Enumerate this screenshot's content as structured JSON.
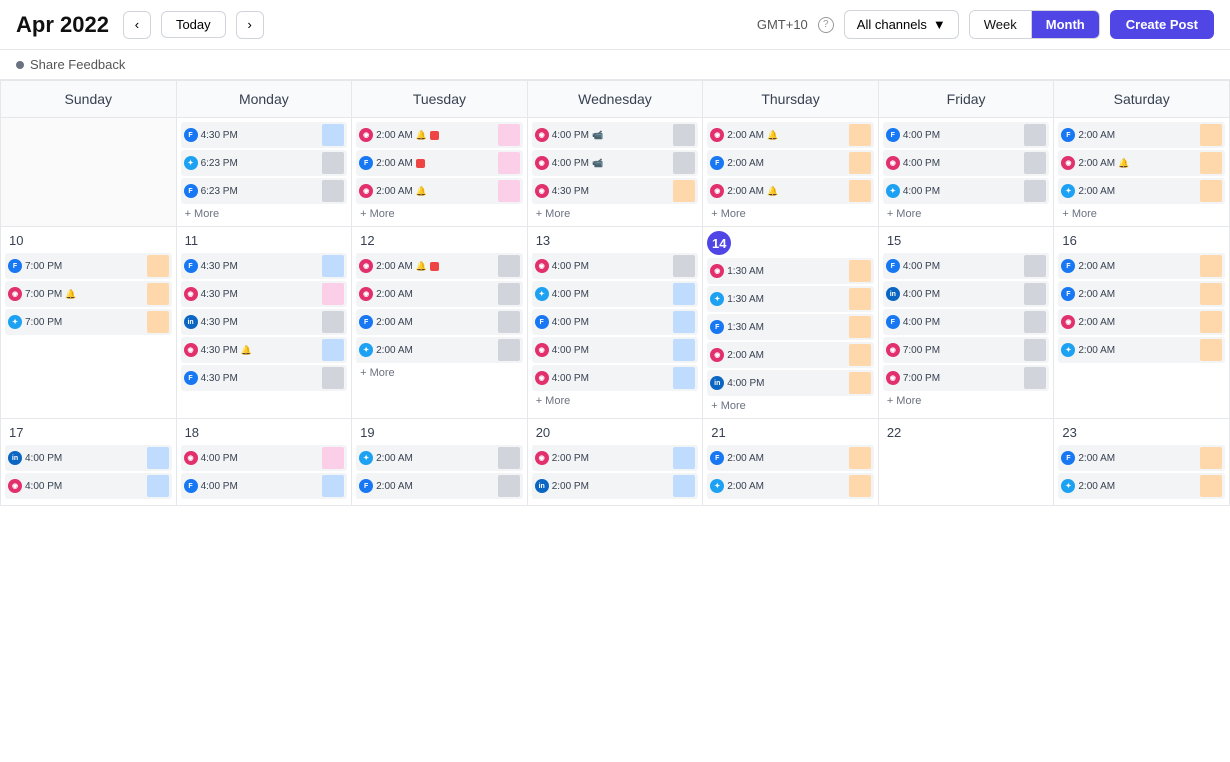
{
  "header": {
    "title": "Apr 2022",
    "today_label": "Today",
    "gmt": "GMT+10",
    "channels_label": "All channels",
    "view_week": "Week",
    "view_month": "Month",
    "create_label": "Create Post"
  },
  "feedback": {
    "label": "Share Feedback"
  },
  "weekdays": [
    "Sunday",
    "Monday",
    "Tuesday",
    "Wednesday",
    "Thursday",
    "Friday",
    "Saturday"
  ],
  "weeks": [
    {
      "days": [
        {
          "num": "",
          "empty": true,
          "events": []
        },
        {
          "num": "",
          "events": [
            {
              "social": "fb",
              "time": "4:30 PM",
              "thumb": "blue"
            },
            {
              "social": "tw",
              "time": "6:23 PM",
              "thumb": "gray"
            },
            {
              "social": "fb",
              "time": "6:23 PM",
              "thumb": "gray"
            }
          ],
          "more": true
        },
        {
          "num": "",
          "events": [
            {
              "social": "ig",
              "time": "2:00 AM",
              "bell": true,
              "stop": true,
              "thumb": "pink"
            },
            {
              "social": "fb",
              "time": "2:00 AM",
              "stop": true,
              "thumb": "pink"
            },
            {
              "social": "ig",
              "time": "2:00 AM",
              "bell": true,
              "thumb": "pink"
            }
          ],
          "more": true
        },
        {
          "num": "",
          "events": [
            {
              "social": "ig",
              "time": "4:00 PM",
              "video": true,
              "thumb": "gray"
            },
            {
              "social": "ig",
              "time": "4:00 PM",
              "video": true,
              "thumb": "gray"
            },
            {
              "social": "ig",
              "time": "4:30 PM",
              "thumb": "orange"
            }
          ],
          "more": true
        },
        {
          "num": "",
          "events": [
            {
              "social": "ig",
              "time": "2:00 AM",
              "bell": true,
              "thumb": "orange"
            },
            {
              "social": "fb",
              "time": "2:00 AM",
              "thumb": "orange"
            },
            {
              "social": "ig",
              "time": "2:00 AM",
              "bell": true,
              "thumb": "orange"
            }
          ],
          "more": true
        },
        {
          "num": "",
          "events": [
            {
              "social": "fb",
              "time": "4:00 PM",
              "thumb": "gray"
            },
            {
              "social": "ig",
              "time": "4:00 PM",
              "thumb": "gray"
            },
            {
              "social": "tw",
              "time": "4:00 PM",
              "thumb": "gray"
            }
          ],
          "more": true
        },
        {
          "num": "",
          "events": [
            {
              "social": "fb",
              "time": "2:00 AM",
              "thumb": "orange"
            },
            {
              "social": "ig",
              "time": "2:00 AM",
              "bell": true,
              "thumb": "orange"
            },
            {
              "social": "tw",
              "time": "2:00 AM",
              "thumb": "orange"
            }
          ],
          "more": true
        }
      ]
    },
    {
      "days": [
        {
          "num": "10",
          "events": [
            {
              "social": "fb",
              "time": "7:00 PM",
              "thumb": "orange"
            },
            {
              "social": "ig",
              "time": "7:00 PM",
              "bell": true,
              "thumb": "orange"
            },
            {
              "social": "tw",
              "time": "7:00 PM",
              "thumb": "orange"
            }
          ]
        },
        {
          "num": "11",
          "events": [
            {
              "social": "fb",
              "time": "4:30 PM",
              "thumb": "blue"
            },
            {
              "social": "ig",
              "time": "4:30 PM",
              "thumb": "pink"
            },
            {
              "social": "li",
              "time": "4:30 PM",
              "thumb": "gray"
            },
            {
              "social": "ig",
              "time": "4:30 PM",
              "bell": true,
              "thumb": "blue"
            },
            {
              "social": "fb",
              "time": "4:30 PM",
              "thumb": "gray"
            }
          ]
        },
        {
          "num": "12",
          "events": [
            {
              "social": "ig",
              "time": "2:00 AM",
              "bell": true,
              "stop": true,
              "thumb": "gray"
            },
            {
              "social": "ig",
              "time": "2:00 AM",
              "thumb": "gray"
            },
            {
              "social": "fb",
              "time": "2:00 AM",
              "thumb": "gray"
            },
            {
              "social": "tw",
              "time": "2:00 AM",
              "thumb": "gray"
            }
          ],
          "more": true
        },
        {
          "num": "13",
          "events": [
            {
              "social": "ig",
              "time": "4:00 PM",
              "thumb": "gray"
            },
            {
              "social": "tw",
              "time": "4:00 PM",
              "thumb": "blue"
            },
            {
              "social": "fb",
              "time": "4:00 PM",
              "thumb": "blue"
            },
            {
              "social": "ig",
              "time": "4:00 PM",
              "thumb": "blue"
            },
            {
              "social": "ig",
              "time": "4:00 PM",
              "thumb": "blue"
            }
          ],
          "more": true
        },
        {
          "num": "14",
          "today": true,
          "events": [
            {
              "social": "ig",
              "time": "1:30 AM",
              "thumb": "orange"
            },
            {
              "social": "tw",
              "time": "1:30 AM",
              "thumb": "orange"
            },
            {
              "social": "fb",
              "time": "1:30 AM",
              "thumb": "orange"
            },
            {
              "social": "ig",
              "time": "2:00 AM",
              "thumb": "orange"
            },
            {
              "social": "li",
              "time": "4:00 PM",
              "thumb": "orange"
            }
          ],
          "more": true
        },
        {
          "num": "15",
          "events": [
            {
              "social": "fb",
              "time": "4:00 PM",
              "thumb": "gray"
            },
            {
              "social": "li",
              "time": "4:00 PM",
              "thumb": "gray"
            },
            {
              "social": "fb",
              "time": "4:00 PM",
              "thumb": "gray"
            },
            {
              "social": "ig",
              "time": "7:00 PM",
              "thumb": "gray"
            },
            {
              "social": "ig",
              "time": "7:00 PM",
              "thumb": "gray"
            }
          ],
          "more": true
        },
        {
          "num": "16",
          "events": [
            {
              "social": "fb",
              "time": "2:00 AM",
              "thumb": "orange"
            },
            {
              "social": "fb",
              "time": "2:00 AM",
              "thumb": "orange"
            },
            {
              "social": "ig",
              "time": "2:00 AM",
              "thumb": "orange"
            },
            {
              "social": "tw",
              "time": "2:00 AM",
              "thumb": "orange"
            }
          ]
        }
      ]
    },
    {
      "days": [
        {
          "num": "17",
          "events": [
            {
              "social": "li",
              "time": "4:00 PM",
              "thumb": "blue"
            },
            {
              "social": "ig",
              "time": "4:00 PM",
              "thumb": "blue"
            }
          ]
        },
        {
          "num": "18",
          "events": [
            {
              "social": "ig",
              "time": "4:00 PM",
              "thumb": "pink"
            },
            {
              "social": "fb",
              "time": "4:00 PM",
              "thumb": "blue"
            }
          ]
        },
        {
          "num": "19",
          "events": [
            {
              "social": "tw",
              "time": "2:00 AM",
              "thumb": "gray"
            },
            {
              "social": "fb",
              "time": "2:00 AM",
              "thumb": "gray"
            }
          ]
        },
        {
          "num": "20",
          "events": [
            {
              "social": "ig",
              "time": "2:00 PM",
              "thumb": "blue"
            },
            {
              "social": "li",
              "time": "2:00 PM",
              "thumb": "blue"
            }
          ]
        },
        {
          "num": "21",
          "events": [
            {
              "social": "fb",
              "time": "2:00 AM",
              "thumb": "orange"
            },
            {
              "social": "tw",
              "time": "2:00 AM",
              "thumb": "orange"
            }
          ]
        },
        {
          "num": "22",
          "events": []
        },
        {
          "num": "23",
          "events": [
            {
              "social": "fb",
              "time": "2:00 AM",
              "thumb": "orange"
            },
            {
              "social": "tw",
              "time": "2:00 AM",
              "thumb": "orange"
            }
          ]
        }
      ]
    }
  ],
  "more_label": "+ More"
}
